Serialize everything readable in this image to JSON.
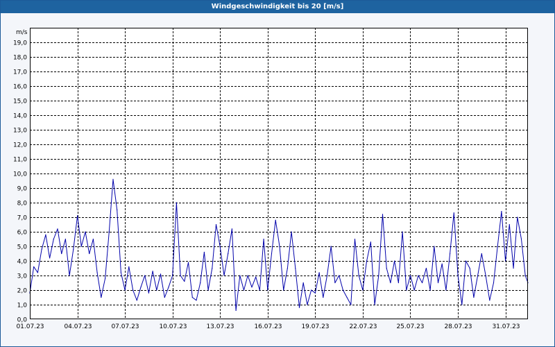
{
  "window": {
    "title": "Windgeschwindigkeit bis 20 [m/s]"
  },
  "chart_data": {
    "type": "line",
    "title": "Windgeschwindigkeit bis 20 [m/s]",
    "ylabel": "m/s",
    "xlabel": "",
    "ylim": [
      0,
      20
    ],
    "xlim": [
      "2023-07-01",
      "2023-08-01T10:00"
    ],
    "grid": true,
    "y_tick_labels": [
      "0,0",
      "1,0",
      "2,0",
      "3,0",
      "4,0",
      "5,0",
      "6,0",
      "7,0",
      "8,0",
      "9,0",
      "10,0",
      "11,0",
      "12,0",
      "13,0",
      "14,0",
      "15,0",
      "16,0",
      "17,0",
      "18,0",
      "19,0"
    ],
    "x_tick_labels": [
      "01.07.23",
      "04.07.23",
      "07.07.23",
      "10.07.23",
      "13.07.23",
      "16.07.23",
      "19.07.23",
      "22.07.23",
      "25.07.23",
      "28.07.23",
      "31.07.23"
    ],
    "x_ticks": [
      "2023-07-01",
      "2023-07-04",
      "2023-07-07",
      "2023-07-10",
      "2023-07-13",
      "2023-07-16",
      "2023-07-19",
      "2023-07-22",
      "2023-07-25",
      "2023-07-28",
      "2023-07-31"
    ],
    "series": [
      {
        "color": "#0000aa",
        "points": [
          [
            "2023-07-01T00:00",
            1.8
          ],
          [
            "2023-07-01T06:00",
            3.6
          ],
          [
            "2023-07-01T12:00",
            3.2
          ],
          [
            "2023-07-01T18:00",
            4.8
          ],
          [
            "2023-07-02T00:00",
            5.8
          ],
          [
            "2023-07-02T06:00",
            4.2
          ],
          [
            "2023-07-02T12:00",
            5.5
          ],
          [
            "2023-07-02T18:00",
            6.2
          ],
          [
            "2023-07-03T00:00",
            4.5
          ],
          [
            "2023-07-03T06:00",
            5.5
          ],
          [
            "2023-07-03T12:00",
            3.0
          ],
          [
            "2023-07-03T18:00",
            4.8
          ],
          [
            "2023-07-04T00:00",
            7.1
          ],
          [
            "2023-07-04T06:00",
            5.0
          ],
          [
            "2023-07-04T12:00",
            6.0
          ],
          [
            "2023-07-04T18:00",
            4.5
          ],
          [
            "2023-07-05T00:00",
            5.5
          ],
          [
            "2023-07-05T06:00",
            3.2
          ],
          [
            "2023-07-05T12:00",
            1.5
          ],
          [
            "2023-07-05T18:00",
            2.8
          ],
          [
            "2023-07-06T00:00",
            6.0
          ],
          [
            "2023-07-06T06:00",
            9.6
          ],
          [
            "2023-07-06T12:00",
            7.5
          ],
          [
            "2023-07-06T18:00",
            3.2
          ],
          [
            "2023-07-07T00:00",
            2.0
          ],
          [
            "2023-07-07T06:00",
            3.6
          ],
          [
            "2023-07-07T12:00",
            2.0
          ],
          [
            "2023-07-07T18:00",
            1.3
          ],
          [
            "2023-07-08T00:00",
            2.2
          ],
          [
            "2023-07-08T06:00",
            3.0
          ],
          [
            "2023-07-08T12:00",
            1.8
          ],
          [
            "2023-07-08T18:00",
            3.3
          ],
          [
            "2023-07-09T00:00",
            2.0
          ],
          [
            "2023-07-09T06:00",
            3.1
          ],
          [
            "2023-07-09T12:00",
            1.5
          ],
          [
            "2023-07-09T18:00",
            2.2
          ],
          [
            "2023-07-10T00:00",
            3.0
          ],
          [
            "2023-07-10T06:00",
            8.0
          ],
          [
            "2023-07-10T12:00",
            3.0
          ],
          [
            "2023-07-10T18:00",
            2.6
          ],
          [
            "2023-07-11T00:00",
            3.9
          ],
          [
            "2023-07-11T06:00",
            1.5
          ],
          [
            "2023-07-11T12:00",
            1.3
          ],
          [
            "2023-07-11T18:00",
            2.5
          ],
          [
            "2023-07-12T00:00",
            4.6
          ],
          [
            "2023-07-12T06:00",
            2.0
          ],
          [
            "2023-07-12T12:00",
            3.5
          ],
          [
            "2023-07-12T18:00",
            6.5
          ],
          [
            "2023-07-13T00:00",
            5.0
          ],
          [
            "2023-07-13T06:00",
            3.0
          ],
          [
            "2023-07-13T12:00",
            4.5
          ],
          [
            "2023-07-13T18:00",
            6.2
          ],
          [
            "2023-07-14T00:00",
            0.6
          ],
          [
            "2023-07-14T06:00",
            3.0
          ],
          [
            "2023-07-14T12:00",
            2.0
          ],
          [
            "2023-07-14T18:00",
            3.0
          ],
          [
            "2023-07-15T00:00",
            2.2
          ],
          [
            "2023-07-15T06:00",
            2.9
          ],
          [
            "2023-07-15T12:00",
            2.0
          ],
          [
            "2023-07-15T18:00",
            5.5
          ],
          [
            "2023-07-16T00:00",
            2.0
          ],
          [
            "2023-07-16T06:00",
            4.5
          ],
          [
            "2023-07-16T12:00",
            6.8
          ],
          [
            "2023-07-16T18:00",
            5.0
          ],
          [
            "2023-07-17T00:00",
            2.0
          ],
          [
            "2023-07-17T06:00",
            3.5
          ],
          [
            "2023-07-17T12:00",
            6.0
          ],
          [
            "2023-07-17T18:00",
            3.5
          ],
          [
            "2023-07-18T00:00",
            0.8
          ],
          [
            "2023-07-18T06:00",
            2.5
          ],
          [
            "2023-07-18T12:00",
            1.0
          ],
          [
            "2023-07-18T18:00",
            2.0
          ],
          [
            "2023-07-19T00:00",
            1.8
          ],
          [
            "2023-07-19T06:00",
            3.2
          ],
          [
            "2023-07-19T12:00",
            1.5
          ],
          [
            "2023-07-19T18:00",
            3.0
          ],
          [
            "2023-07-20T00:00",
            5.0
          ],
          [
            "2023-07-20T06:00",
            2.5
          ],
          [
            "2023-07-20T12:00",
            3.0
          ],
          [
            "2023-07-20T18:00",
            2.0
          ],
          [
            "2023-07-21T00:00",
            1.5
          ],
          [
            "2023-07-21T06:00",
            1.0
          ],
          [
            "2023-07-21T12:00",
            5.5
          ],
          [
            "2023-07-21T18:00",
            3.0
          ],
          [
            "2023-07-22T00:00",
            2.0
          ],
          [
            "2023-07-22T06:00",
            4.0
          ],
          [
            "2023-07-22T12:00",
            5.3
          ],
          [
            "2023-07-22T18:00",
            1.0
          ],
          [
            "2023-07-23T00:00",
            3.0
          ],
          [
            "2023-07-23T06:00",
            7.2
          ],
          [
            "2023-07-23T12:00",
            3.5
          ],
          [
            "2023-07-23T18:00",
            2.5
          ],
          [
            "2023-07-24T00:00",
            4.0
          ],
          [
            "2023-07-24T06:00",
            2.5
          ],
          [
            "2023-07-24T12:00",
            6.0
          ],
          [
            "2023-07-24T18:00",
            2.0
          ],
          [
            "2023-07-25T00:00",
            3.0
          ],
          [
            "2023-07-25T06:00",
            2.0
          ],
          [
            "2023-07-25T12:00",
            3.0
          ],
          [
            "2023-07-25T18:00",
            2.5
          ],
          [
            "2023-07-26T00:00",
            3.5
          ],
          [
            "2023-07-26T06:00",
            2.0
          ],
          [
            "2023-07-26T12:00",
            5.0
          ],
          [
            "2023-07-26T18:00",
            2.5
          ],
          [
            "2023-07-27T00:00",
            3.8
          ],
          [
            "2023-07-27T06:00",
            2.0
          ],
          [
            "2023-07-27T12:00",
            4.5
          ],
          [
            "2023-07-27T18:00",
            7.3
          ],
          [
            "2023-07-28T00:00",
            3.0
          ],
          [
            "2023-07-28T06:00",
            1.0
          ],
          [
            "2023-07-28T12:00",
            4.0
          ],
          [
            "2023-07-28T18:00",
            3.5
          ],
          [
            "2023-07-29T00:00",
            1.5
          ],
          [
            "2023-07-29T06:00",
            3.0
          ],
          [
            "2023-07-29T12:00",
            4.5
          ],
          [
            "2023-07-29T18:00",
            3.0
          ],
          [
            "2023-07-30T00:00",
            1.3
          ],
          [
            "2023-07-30T06:00",
            2.5
          ],
          [
            "2023-07-30T12:00",
            5.0
          ],
          [
            "2023-07-30T18:00",
            7.4
          ],
          [
            "2023-07-31T00:00",
            4.0
          ],
          [
            "2023-07-31T06:00",
            6.5
          ],
          [
            "2023-07-31T12:00",
            3.5
          ],
          [
            "2023-07-31T18:00",
            7.0
          ],
          [
            "2023-08-01T00:00",
            5.5
          ],
          [
            "2023-08-01T06:00",
            3.0
          ],
          [
            "2023-08-01T10:00",
            2.5
          ]
        ]
      }
    ]
  }
}
